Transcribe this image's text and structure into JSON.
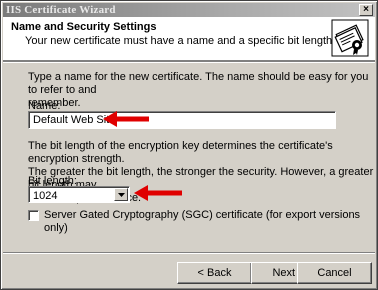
{
  "window": {
    "title": "IIS Certificate Wizard",
    "close_label": "×"
  },
  "header": {
    "heading": "Name and Security Settings",
    "subheading": "Your new certificate must have a name and a specific bit length.",
    "icon": "certificate-icon"
  },
  "form": {
    "intro_line1": "Type a name for the new certificate. The name should be easy for you to refer to and",
    "intro_line2": "remember.",
    "name_label": "Name:",
    "name_value": "Default Web Site",
    "bitlength_desc_line1": "The bit length of the encryption key determines the certificate's encryption strength.",
    "bitlength_desc_line2": "The greater the bit length, the stronger the security. However, a greater bit length may",
    "bitlength_desc_line3": "decrease performance.",
    "bitlength_label": "Bit length:",
    "bitlength_value": "1024",
    "sgc_label": "Server Gated Cryptography (SGC) certificate (for export versions only)",
    "sgc_checked": false
  },
  "buttons": {
    "back": "< Back",
    "next": "Next >",
    "cancel": "Cancel"
  },
  "colors": {
    "annotation_arrow": "#e00000",
    "titlebar": "#8a8a8a",
    "dialog_face": "#d4d0c8"
  }
}
